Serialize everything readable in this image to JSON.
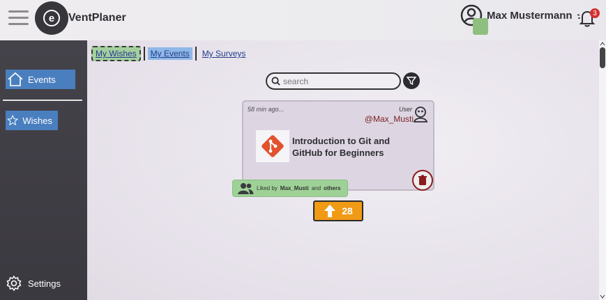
{
  "header": {
    "app_name": "VentPlaner",
    "user_name": "Max Mustermann",
    "notification_count": "3",
    "logo_letter": "e"
  },
  "sidebar": {
    "items": [
      {
        "label": "Events",
        "icon": "home-icon"
      },
      {
        "label": "Wishes",
        "icon": "star-icon"
      }
    ],
    "settings_label": "Settings"
  },
  "tabs": [
    {
      "label": "My Wishes"
    },
    {
      "label": "My Events"
    },
    {
      "label": "My Surveys"
    }
  ],
  "search": {
    "placeholder": "search"
  },
  "card": {
    "time_ago": "58 min ago...",
    "user_label": "User",
    "user_handle": "@Max_Musti",
    "title": "Introduction to Git and GitHub for Beginners"
  },
  "liked": {
    "prefix": "Liked by",
    "user": "Max_Musti",
    "and": "and",
    "others": "others"
  },
  "upvote": {
    "count": "28"
  },
  "colors": {
    "sidebar_highlight": "#4a7fbf",
    "active_tab": "#a4cf9f",
    "upvote": "#f09a16",
    "delete": "#8c1b1b",
    "notification": "#d23030"
  }
}
